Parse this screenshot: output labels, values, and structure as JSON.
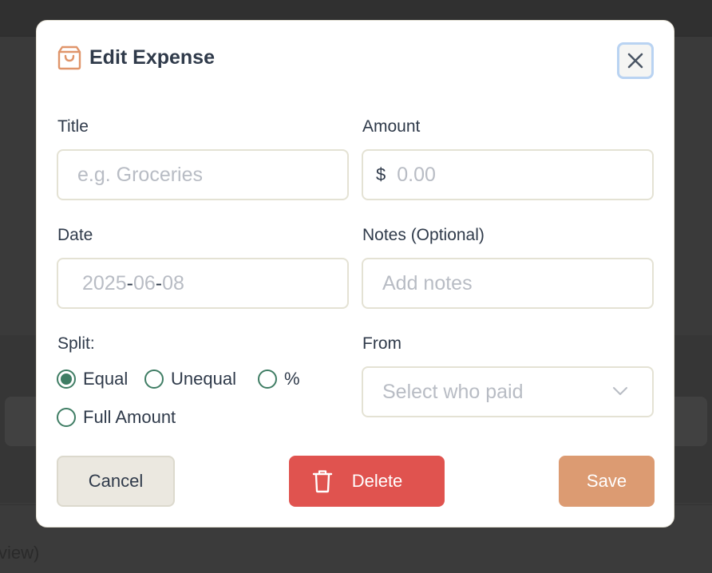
{
  "background": {
    "partial_text": "view)"
  },
  "modal": {
    "title": "Edit Expense",
    "icon": "shopping-bag-icon",
    "close_icon": "close-icon"
  },
  "form": {
    "title_label": "Title",
    "title_placeholder": "e.g. Groceries",
    "amount_label": "Amount",
    "currency_symbol": "$",
    "amount_placeholder": "0.00",
    "date_label": "Date",
    "date_year": "2025",
    "date_month": "06",
    "date_day": "08",
    "date_separator": "-",
    "notes_label": "Notes (Optional)",
    "notes_placeholder": "Add notes",
    "split_label": "Split:",
    "split_options": [
      {
        "label": "Equal",
        "selected": true
      },
      {
        "label": "Unequal",
        "selected": false
      },
      {
        "label": "%",
        "selected": false
      },
      {
        "label": "Full Amount",
        "selected": false
      }
    ],
    "from_label": "From",
    "from_placeholder": "Select who paid"
  },
  "buttons": {
    "cancel": "Cancel",
    "delete": "Delete",
    "save": "Save"
  },
  "colors": {
    "accent_green": "#3f7d64",
    "delete_red": "#e0534f",
    "save_orange": "#dc9b72",
    "icon_orange": "#e0956a"
  }
}
